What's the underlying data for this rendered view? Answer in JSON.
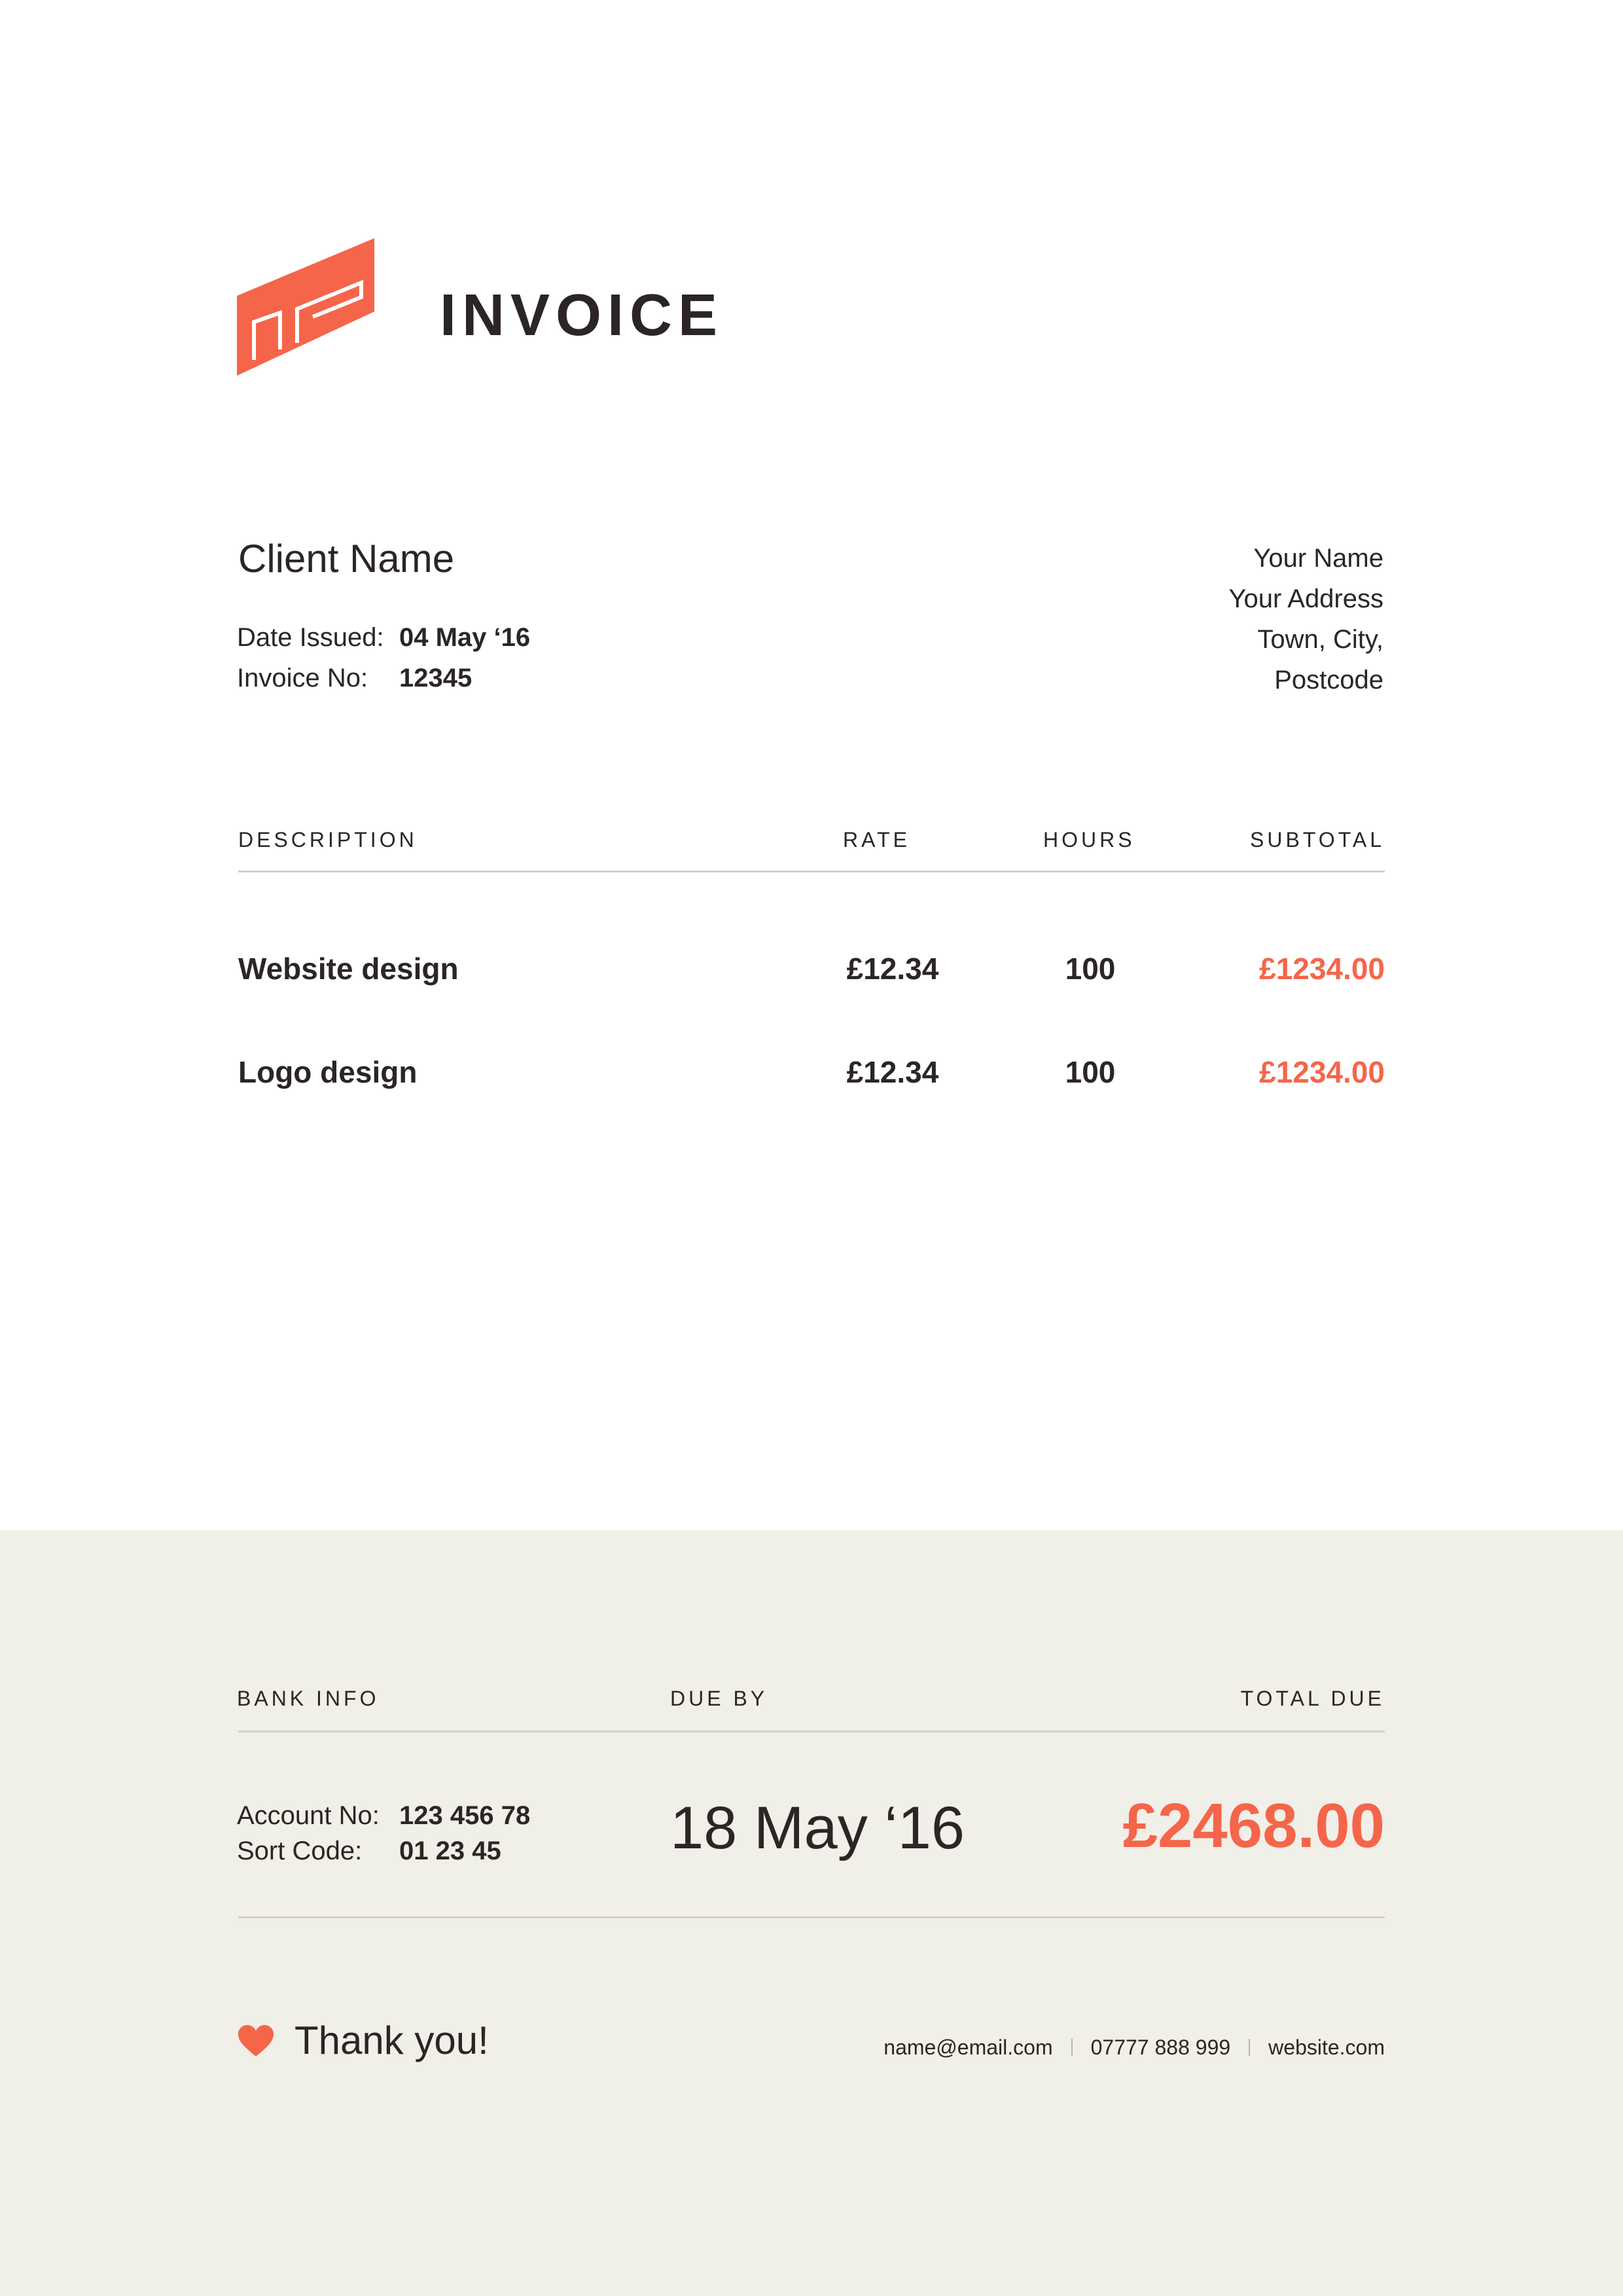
{
  "header": {
    "title": "INVOICE",
    "logo_icon": "brand-logo-icon",
    "accent_color": "#f5654a"
  },
  "client": {
    "name": "Client Name",
    "date_label": "Date Issued:",
    "date_value": "04 May ‘16",
    "invoice_label": "Invoice No:",
    "invoice_value": "12345"
  },
  "sender": {
    "lines": [
      "Your Name",
      "Your Address",
      "Town, City,",
      "Postcode"
    ]
  },
  "table": {
    "columns": [
      "DESCRIPTION",
      "RATE",
      "HOURS",
      "SUBTOTAL"
    ],
    "rows": [
      {
        "description": "Website design",
        "rate": "£12.34",
        "hours": "100",
        "subtotal": "£1234.00"
      },
      {
        "description": "Logo design",
        "rate": "£12.34",
        "hours": "100",
        "subtotal": "£1234.00"
      }
    ]
  },
  "footer": {
    "background_color": "#f0efe8",
    "headers": {
      "bank": "BANK INFO",
      "due": "DUE BY",
      "total": "TOTAL DUE"
    },
    "bank": {
      "account_label": "Account No:",
      "account_value": "123 456 78",
      "sort_label": "Sort Code:",
      "sort_value": "01 23 45"
    },
    "due_date": "18 May ‘16",
    "total_due": "£2468.00",
    "thanks": "Thank you!",
    "heart_icon": "heart-icon",
    "contacts": {
      "email": "name@email.com",
      "phone": "07777 888 999",
      "website": "website.com"
    }
  }
}
